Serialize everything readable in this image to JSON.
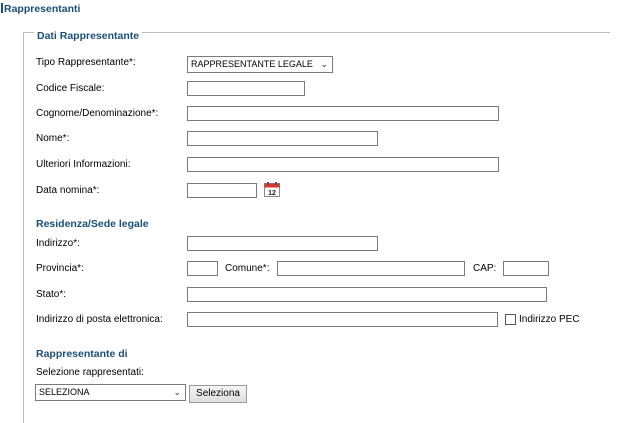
{
  "page": {
    "title": "Rappresentanti"
  },
  "dati": {
    "legend": "Dati Rappresentante",
    "tipo_label": "Tipo Rappresentante*:",
    "tipo_value": "RAPPRESENTANTE LEGALE",
    "codice_fiscale_label": "Codice Fiscale:",
    "cognome_label": "Cognome/Denominazione*:",
    "nome_label": "Nome*:",
    "ulteriori_label": "Ulteriori Informazioni:",
    "data_nomina_label": "Data nomina*:"
  },
  "residenza": {
    "title": "Residenza/Sede legale",
    "indirizzo_label": "Indirizzo*:",
    "provincia_label": "Provincia*:",
    "comune_label": "Comune*:",
    "cap_label": "CAP:",
    "stato_label": "Stato*:",
    "email_label": "Indirizzo di posta elettronica:",
    "pec_label": "Indirizzo PEC"
  },
  "rappresentante_di": {
    "title": "Rappresentante di",
    "selezione_label": "Selezione rappresentati:",
    "select_value": "SELEZIONA",
    "button_label": "Seleziona"
  },
  "icons": {
    "calendar": "calendar-icon",
    "chevron": "chevron-down-icon"
  },
  "colors": {
    "accent": "#1b4f7a"
  }
}
